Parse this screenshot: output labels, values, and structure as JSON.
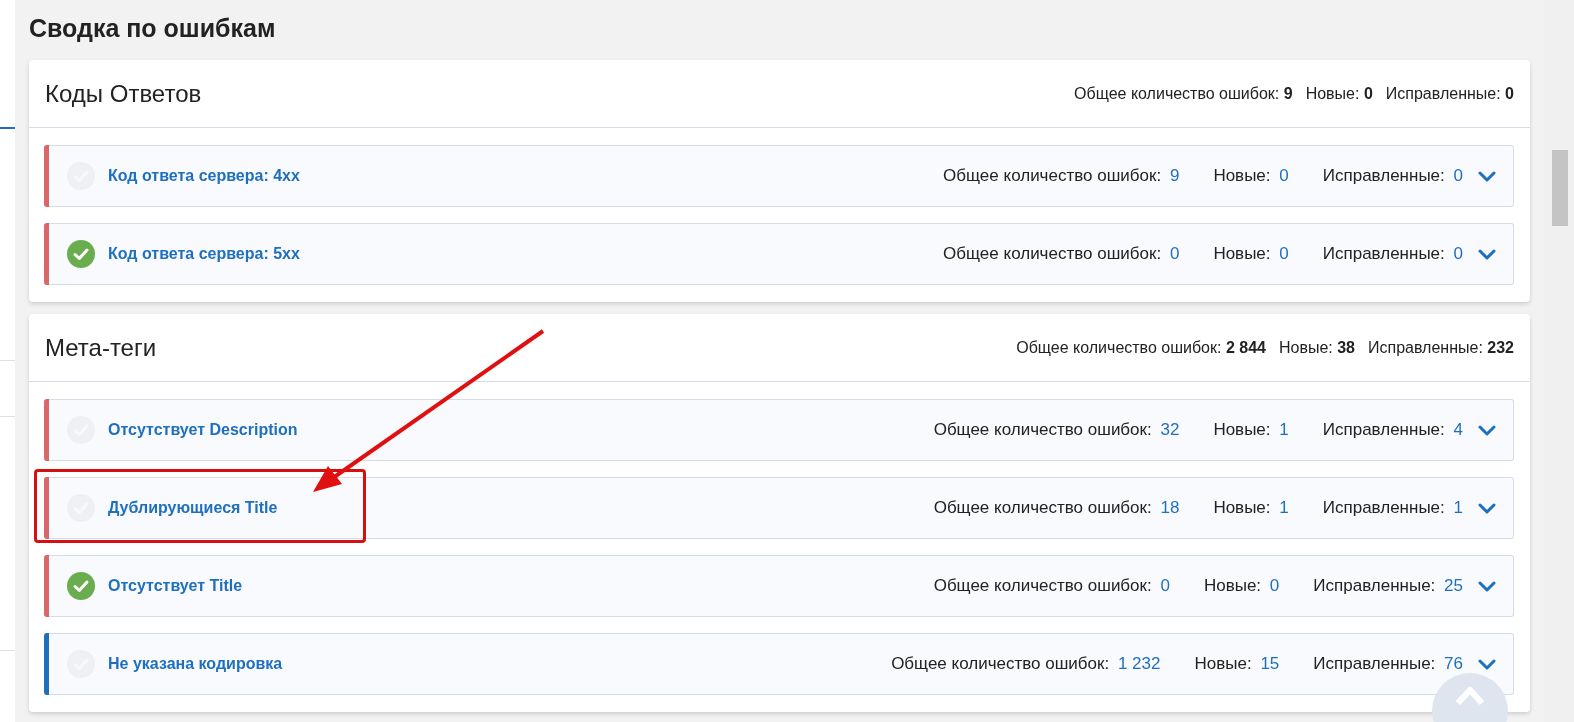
{
  "page_title": "Сводка по ошибкам",
  "sections": [
    {
      "title": "Коды Ответов",
      "totals": {
        "total_label": "Общее количество ошибок:",
        "total": "9",
        "new_label": "Новые:",
        "new": "0",
        "fixed_label": "Исправленные:",
        "fixed": "0"
      },
      "rows": [
        {
          "name": "Код ответа сервера: 4xx",
          "done": false,
          "color": "#d9676a",
          "highlighted": false,
          "total_label": "Общее количество ошибок:",
          "total": "9",
          "new_label": "Новые:",
          "new": "0",
          "fixed_label": "Исправленные:",
          "fixed": "0",
          "expanded": false
        },
        {
          "name": "Код ответа сервера: 5xx",
          "done": true,
          "color": "#d9676a",
          "highlighted": false,
          "total_label": "Общее количество ошибок:",
          "total": "0",
          "new_label": "Новые:",
          "new": "0",
          "fixed_label": "Исправленные:",
          "fixed": "0",
          "expanded": false
        }
      ]
    },
    {
      "title": "Мета-теги",
      "totals": {
        "total_label": "Общее количество ошибок:",
        "total": "2 844",
        "new_label": "Новые:",
        "new": "38",
        "fixed_label": "Исправленные:",
        "fixed": "232"
      },
      "rows": [
        {
          "name": "Отсутствует Description",
          "done": false,
          "color": "#d9676a",
          "highlighted": false,
          "total_label": "Общее количество ошибок:",
          "total": "32",
          "new_label": "Новые:",
          "new": "1",
          "fixed_label": "Исправленные:",
          "fixed": "4",
          "expanded": false
        },
        {
          "name": "Дублирующиеся Title",
          "done": false,
          "color": "#d9676a",
          "highlighted": true,
          "total_label": "Общее количество ошибок:",
          "total": "18",
          "new_label": "Новые:",
          "new": "1",
          "fixed_label": "Исправленные:",
          "fixed": "1",
          "expanded": false
        },
        {
          "name": "Отсутствует Title",
          "done": true,
          "color": "#d9676a",
          "highlighted": false,
          "total_label": "Общее количество ошибок:",
          "total": "0",
          "new_label": "Новые:",
          "new": "0",
          "fixed_label": "Исправленные:",
          "fixed": "25",
          "expanded": false
        },
        {
          "name": "Не указана кодировка",
          "done": false,
          "color": "#1f6fbf",
          "highlighted": false,
          "total_label": "Общее количество ошибок:",
          "total": "1 232",
          "new_label": "Новые:",
          "new": "15",
          "fixed_label": "Исправленные:",
          "fixed": "76",
          "expanded": false
        }
      ]
    }
  ]
}
